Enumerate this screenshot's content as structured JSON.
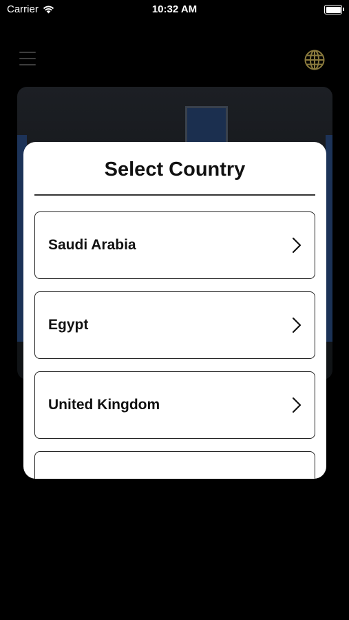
{
  "status_bar": {
    "carrier": "Carrier",
    "time": "10:32 AM"
  },
  "header": {
    "menu_icon": "hamburger-menu-icon",
    "language_icon": "globe-icon"
  },
  "modal": {
    "title": "Select Country",
    "countries": [
      {
        "name": "Saudi Arabia",
        "icon": "chevron-right-icon"
      },
      {
        "name": "Egypt",
        "icon": "chevron-right-icon"
      },
      {
        "name": "United Kingdom",
        "icon": "chevron-right-icon"
      },
      {
        "name": "",
        "icon": ""
      }
    ]
  },
  "colors": {
    "background": "#000000",
    "modal": "#ffffff",
    "text": "#111111",
    "globe": "#8a7a3d",
    "menu": "#3d3d3d"
  }
}
